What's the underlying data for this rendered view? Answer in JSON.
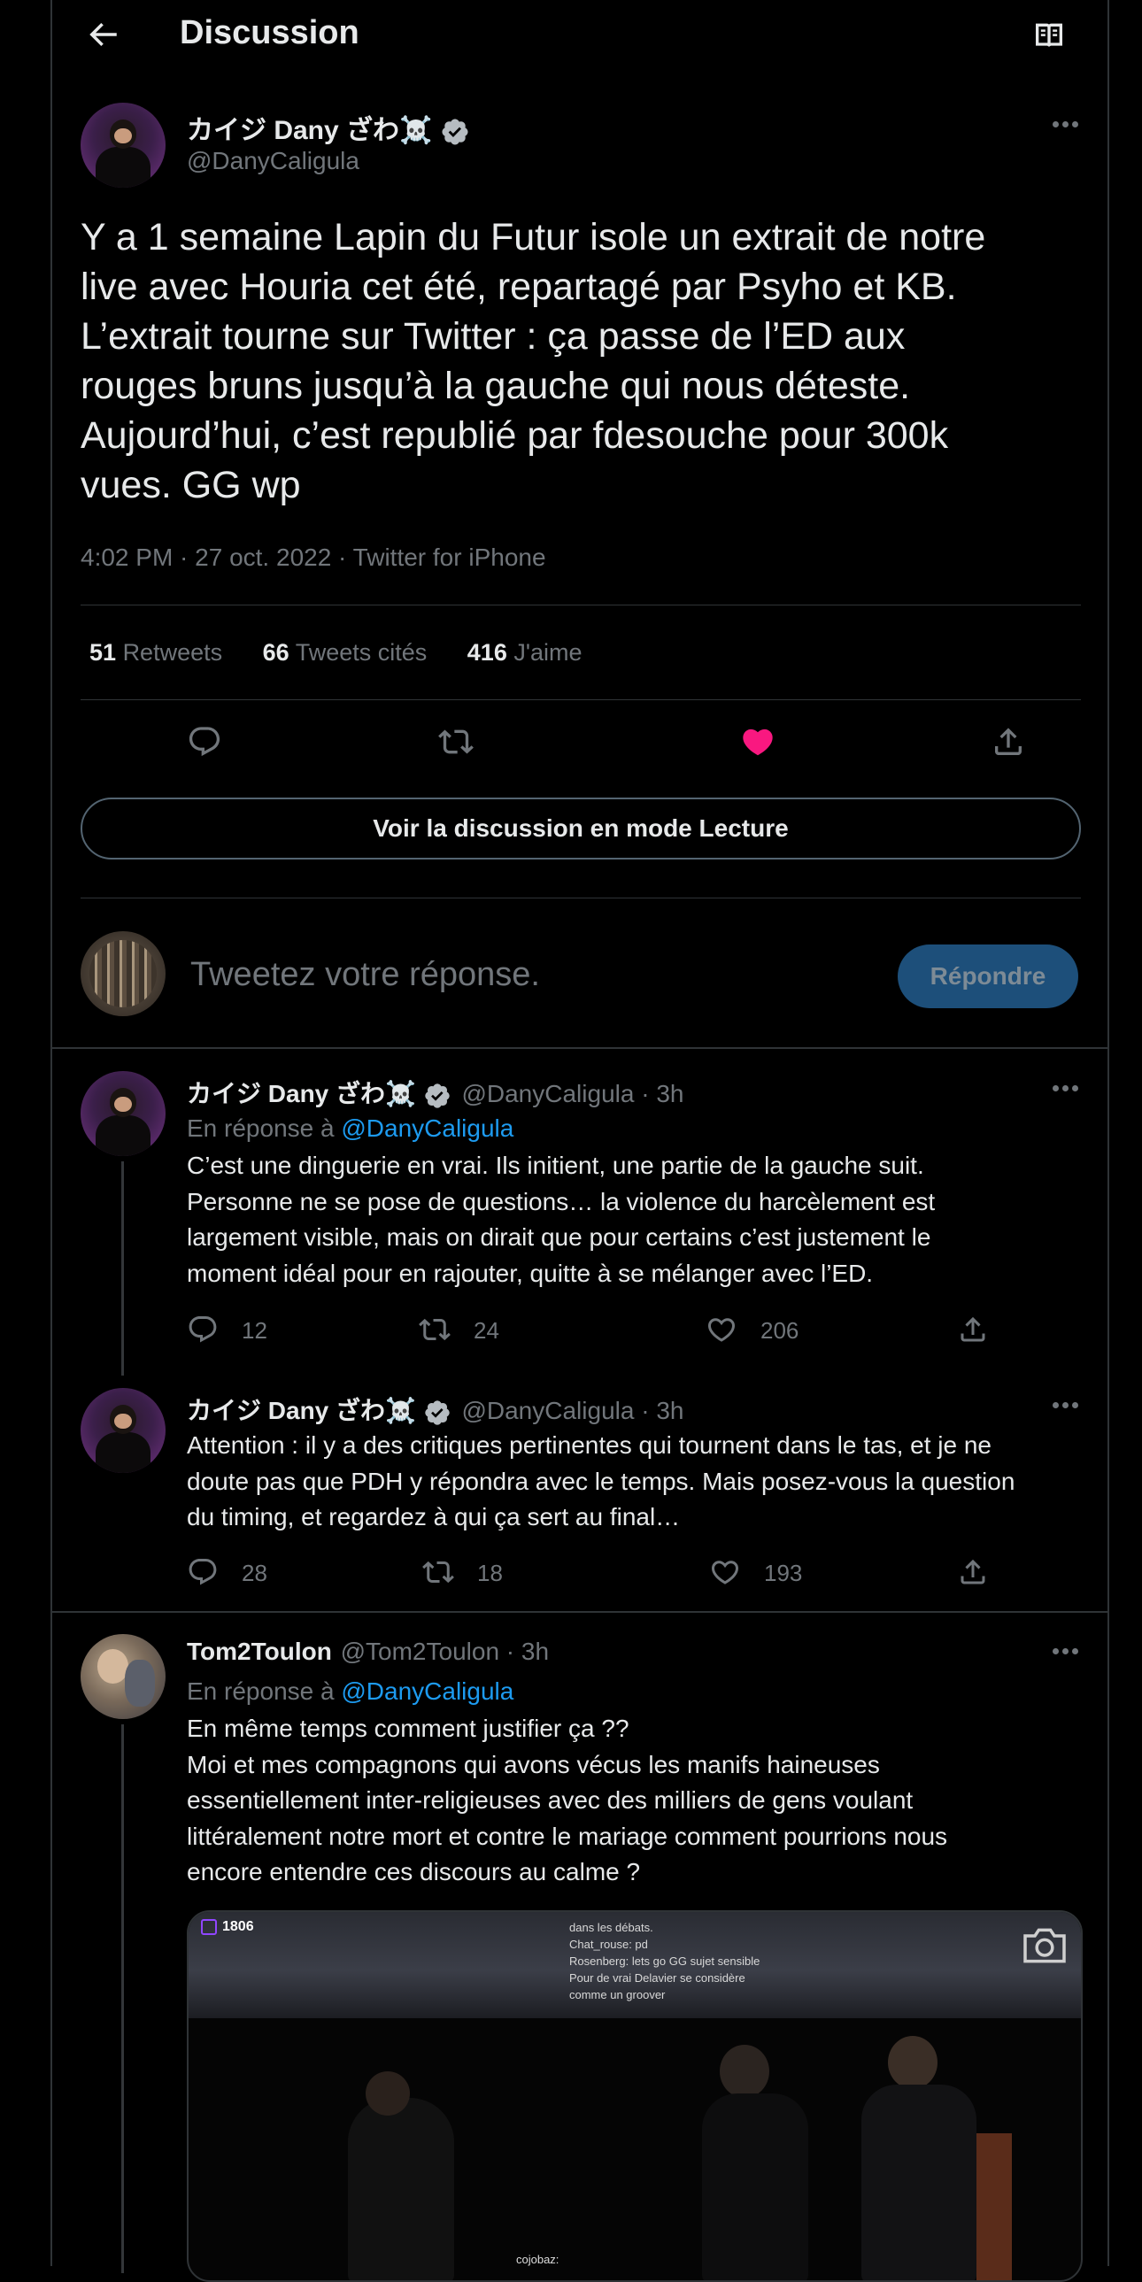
{
  "header": {
    "title": "Discussion"
  },
  "main_tweet": {
    "author_name": "カイジ Dany ざわ☠️",
    "author_handle": "@DanyCaligula",
    "lines": [
      "Y a 1 semaine Lapin du Futur isole un extrait de notre",
      "live avec Houria cet été, repartagé par Psyho et KB.",
      "L’extrait tourne sur Twitter : ça passe de l’ED aux",
      "rouges bruns jusqu’à la gauche qui nous déteste.",
      "Aujourd’hui, c’est republié par fdesouche pour 300k",
      "vues. GG wp"
    ],
    "meta": "4:02 PM · 27 oct. 2022 · Twitter for iPhone",
    "stats": {
      "retweets_count": "51",
      "retweets_label": "Retweets",
      "quotes_count": "66",
      "quotes_label": "Tweets cités",
      "likes_count": "416",
      "likes_label": "J'aime"
    },
    "liked": true,
    "reader_mode_label": "Voir la discussion en mode Lecture"
  },
  "compose": {
    "placeholder": "Tweetez votre réponse.",
    "reply_label": "Répondre"
  },
  "replies": [
    {
      "author_name": "カイジ Dany ざわ☠️",
      "handle_time": "@DanyCaligula · 3h",
      "reply_to_prefix": "En réponse à",
      "reply_to_handle": "@DanyCaligula",
      "lines": [
        "C’est une dinguerie en vrai. Ils initient, une partie de la gauche suit.",
        "Personne ne se pose de questions… la violence du harcèlement est",
        "largement visible, mais on dirait que pour certains c’est justement le",
        "moment idéal pour en rajouter, quitte à se mélanger avec l’ED."
      ],
      "replies_count": "12",
      "retweets_count": "24",
      "likes_count": "206"
    },
    {
      "author_name": "カイジ Dany ざわ☠️",
      "handle_time": "@DanyCaligula · 3h",
      "lines": [
        "Attention : il y a des critiques pertinentes qui tournent dans le tas, et je ne",
        "doute pas que PDH y répondra avec le temps. Mais posez-vous la question",
        "du timing, et regardez à qui ça sert au final…"
      ],
      "replies_count": "28",
      "retweets_count": "18",
      "likes_count": "193"
    },
    {
      "author_name": "Tom2Toulon",
      "handle_time": "@Tom2Toulon · 3h",
      "reply_to_prefix": "En réponse à",
      "reply_to_handle": "@DanyCaligula",
      "lines": [
        "En même temps comment justifier ça ??",
        "Moi et mes compagnons qui avons vécus les manifs haineuses",
        "essentiellement inter-religieuses avec des milliers de gens voulant",
        "littéralement notre mort et contre le mariage comment pourrions nous",
        "encore entendre ces discours au calme ?"
      ],
      "media": {
        "viewer_count": "1806",
        "chat_lines": [
          "dans les débats.",
          "Chat_rouse: pd",
          "Rosenberg: lets go GG sujet sensible",
          "Pour de vrai Delavier se considère",
          "comme un groover"
        ],
        "bottom_text": "cojobaz:"
      }
    }
  ],
  "colors": {
    "like": "#f91880",
    "link": "#1d9bf0",
    "muted": "#71767b",
    "border": "#2f3336"
  }
}
